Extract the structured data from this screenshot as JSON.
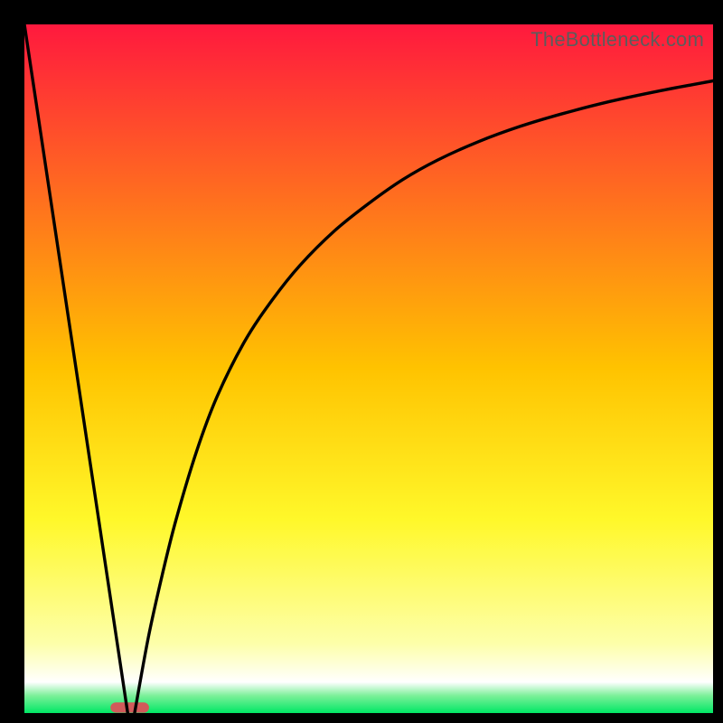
{
  "watermark": "TheBottleneck.com",
  "chart_data": {
    "type": "line",
    "title": "",
    "xlabel": "",
    "ylabel": "",
    "xlim": [
      0,
      100
    ],
    "ylim": [
      0,
      100
    ],
    "grid": false,
    "legend": false,
    "background_gradient": {
      "stops": [
        {
          "offset": 0.0,
          "color": "#ff193e"
        },
        {
          "offset": 0.5,
          "color": "#ffc300"
        },
        {
          "offset": 0.72,
          "color": "#fff82a"
        },
        {
          "offset": 0.9,
          "color": "#fdffaa"
        },
        {
          "offset": 0.955,
          "color": "#ffffff"
        },
        {
          "offset": 0.975,
          "color": "#7af098"
        },
        {
          "offset": 1.0,
          "color": "#00e765"
        }
      ]
    },
    "marker": {
      "x": 15.3,
      "y": 0.8,
      "width": 5.6,
      "height": 1.5,
      "color": "#d15a5a"
    },
    "series": [
      {
        "name": "left-line",
        "x": [
          0,
          15
        ],
        "y": [
          100,
          0
        ]
      },
      {
        "name": "right-curve",
        "x": [
          16,
          18,
          20,
          22,
          25,
          28,
          32,
          36,
          40,
          45,
          50,
          55,
          60,
          66,
          72,
          78,
          85,
          92,
          100
        ],
        "y": [
          0,
          11,
          20,
          28,
          38,
          46,
          54,
          60,
          65,
          70,
          74,
          77.5,
          80.3,
          83,
          85.2,
          87,
          88.8,
          90.3,
          91.8
        ]
      }
    ]
  }
}
